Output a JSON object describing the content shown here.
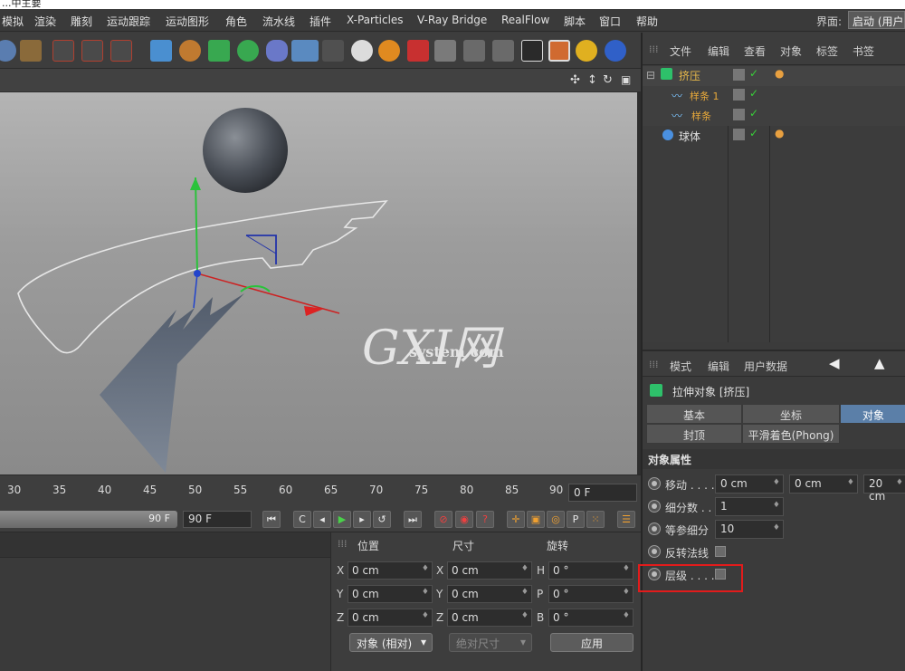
{
  "top_strip": "...中主要",
  "menu": [
    "模拟",
    "渲染",
    "雕刻",
    "运动跟踪",
    "运动图形",
    "角色",
    "流水线",
    "插件",
    "X-Particles",
    "V-Ray Bridge",
    "RealFlow",
    "脚本",
    "窗口",
    "帮助"
  ],
  "layout": {
    "label": "界面:",
    "value": "启动 (用户"
  },
  "timeline": {
    "ticks": [
      "30",
      "35",
      "40",
      "45",
      "50",
      "55",
      "60",
      "65",
      "70",
      "75",
      "80",
      "85",
      "90"
    ],
    "current_frame": "0 F"
  },
  "transport": {
    "slider_label": "90 F",
    "end_frame": "90 F"
  },
  "coords": {
    "headers": {
      "position": "位置",
      "size": "尺寸",
      "rotation": "旋转"
    },
    "rows": [
      {
        "pos_axis": "X",
        "pos": "0 cm",
        "size_axis": "X",
        "size": "0 cm",
        "rot_axis": "H",
        "rot": "0 °"
      },
      {
        "pos_axis": "Y",
        "pos": "0 cm",
        "size_axis": "Y",
        "size": "0 cm",
        "rot_axis": "P",
        "rot": "0 °"
      },
      {
        "pos_axis": "Z",
        "pos": "0 cm",
        "size_axis": "Z",
        "size": "0 cm",
        "rot_axis": "B",
        "rot": "0 °"
      }
    ],
    "mode_dropdown": "对象 (相对)",
    "size_dropdown": "绝对尺寸",
    "apply": "应用"
  },
  "object_manager": {
    "menu": [
      "文件",
      "编辑",
      "查看",
      "对象",
      "标签",
      "书签"
    ],
    "objects": [
      {
        "name": "挤压",
        "color": "#e8b94a"
      },
      {
        "name": "样条 1",
        "color": "#e8a93a"
      },
      {
        "name": "样条",
        "color": "#e8a93a"
      },
      {
        "name": "球体",
        "color": "#e0e0e0"
      }
    ]
  },
  "attributes": {
    "menu": [
      "模式",
      "编辑",
      "用户数据"
    ],
    "title": "拉伸对象 [挤压]",
    "tabs": [
      "基本",
      "坐标",
      "对象",
      "封顶",
      "平滑着色(Phong)"
    ],
    "active_tab": "对象",
    "section": "对象属性",
    "props": [
      {
        "label": "移动 . . . .",
        "values": [
          "0 cm",
          "0 cm",
          "20 cm"
        ]
      },
      {
        "label": "细分数 . .",
        "values": [
          "1"
        ]
      },
      {
        "label": "等参细分",
        "values": [
          "10"
        ]
      },
      {
        "label": "反转法线",
        "values": []
      },
      {
        "label": "层级 . . . .",
        "values": []
      }
    ]
  },
  "watermark": {
    "brand": "GXI网",
    "domain": "system.com"
  },
  "colors": {
    "highlight": "#e21b1b",
    "active_tab": "#5b7fa8"
  }
}
